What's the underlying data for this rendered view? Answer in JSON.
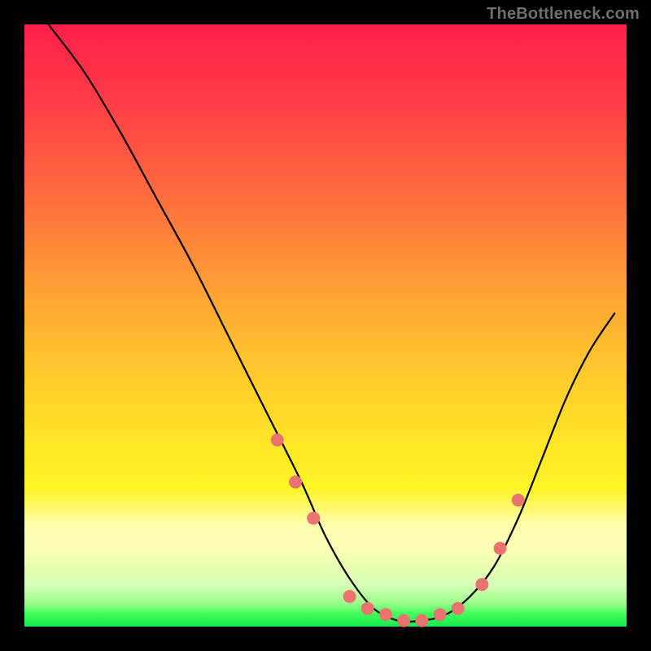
{
  "attribution": "TheBottleneck.com",
  "chart_data": {
    "type": "line",
    "title": "",
    "xlabel": "",
    "ylabel": "",
    "xlim": [
      0,
      100
    ],
    "ylim": [
      0,
      100
    ],
    "series": [
      {
        "name": "bottleneck-curve",
        "x": [
          4,
          10,
          16,
          22,
          28,
          34,
          40,
          46,
          50,
          54,
          58,
          62,
          66,
          70,
          74,
          78,
          82,
          86,
          90,
          94,
          98
        ],
        "values": [
          100,
          92,
          82,
          71,
          60,
          48,
          36,
          24,
          15,
          8,
          3,
          1,
          1,
          2,
          5,
          10,
          18,
          28,
          38,
          46,
          52
        ]
      }
    ],
    "markers": {
      "name": "highlighted-points",
      "color": "#e9746f",
      "x": [
        42,
        45,
        48,
        54,
        57,
        60,
        63,
        66,
        69,
        72,
        76,
        79,
        82
      ],
      "values": [
        31,
        24,
        18,
        5,
        3,
        2,
        1,
        1,
        2,
        3,
        7,
        13,
        21
      ]
    }
  }
}
